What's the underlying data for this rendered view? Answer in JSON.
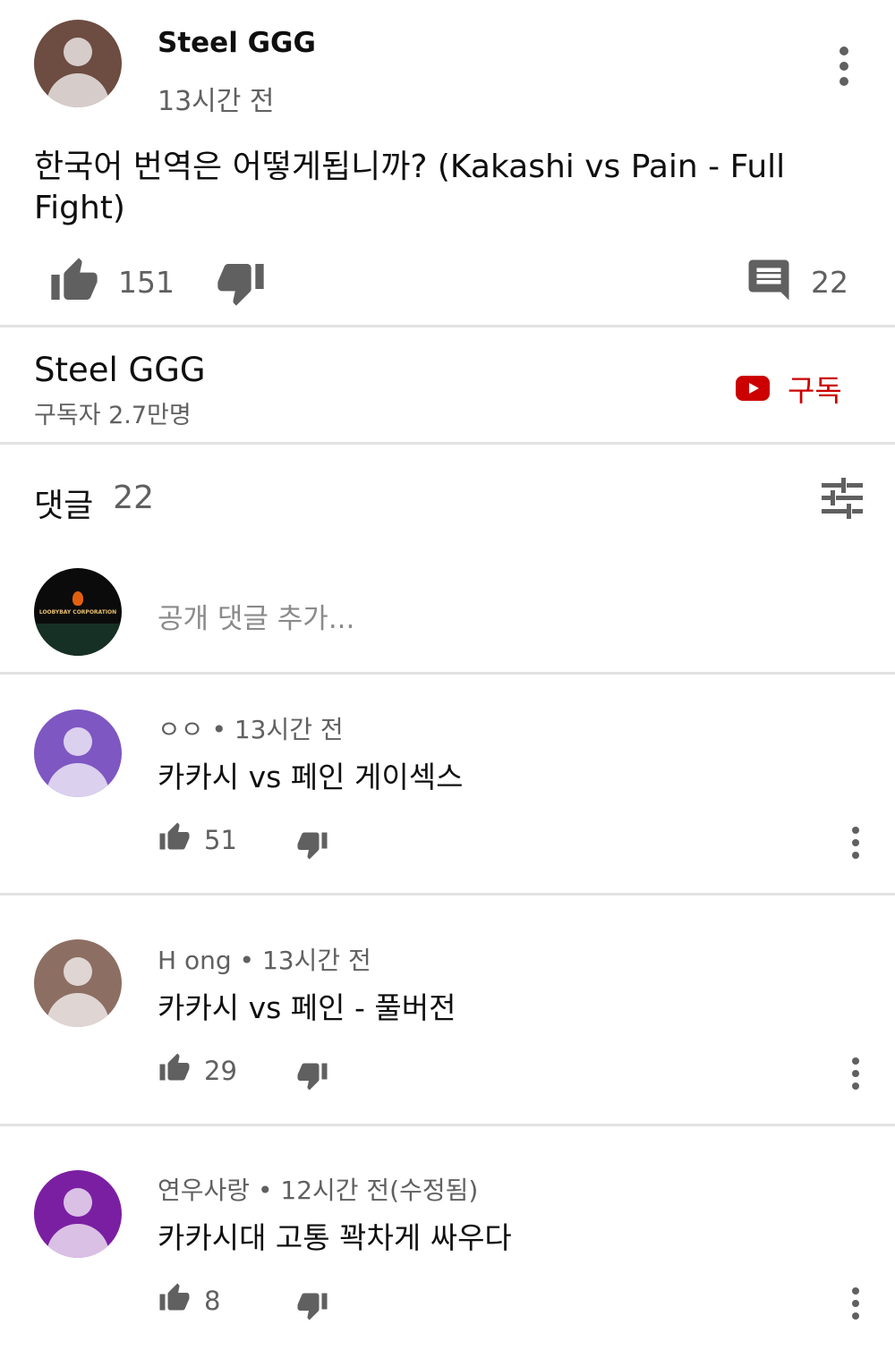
{
  "post": {
    "author": "Steel GGG",
    "time": "13시간 전",
    "text": "한국어 번역은 어떻게됩니까? (Kakashi vs Pain - Full Fight)",
    "likes": "151",
    "replies": "22",
    "avatar_color": "#6d4c41"
  },
  "channel": {
    "name": "Steel GGG",
    "subscribers": "구독자 2.7만명",
    "subscribe_label": "구독",
    "subscribe_color": "#cc0000"
  },
  "comments_header": {
    "label": "댓글",
    "count": "22"
  },
  "add_comment": {
    "placeholder": "공개 댓글 추가...",
    "avatar_text": "LOOBYBAY CORPORATION"
  },
  "comments": [
    {
      "author": "ㅇㅇ",
      "time": "13시간 전",
      "text": "카카시 vs 페인 게이섹스",
      "likes": "51",
      "avatar_color": "#7e57c2"
    },
    {
      "author": "H ong",
      "time": "13시간 전",
      "text": "카카시 vs 페인 - 풀버전",
      "likes": "29",
      "avatar_color": "#8d6e63"
    },
    {
      "author": "연우사랑",
      "time": "12시간 전(수정됨)",
      "text": "카카시대 고통 꽉차게 싸우다",
      "likes": "8",
      "avatar_color": "#7b1fa2"
    }
  ],
  "icons": {
    "like": "thumb-up-icon",
    "dislike": "thumb-down-icon",
    "reply": "comment-icon",
    "more": "more-vert-icon",
    "sort": "sort-icon",
    "youtube": "youtube-logo-icon"
  }
}
